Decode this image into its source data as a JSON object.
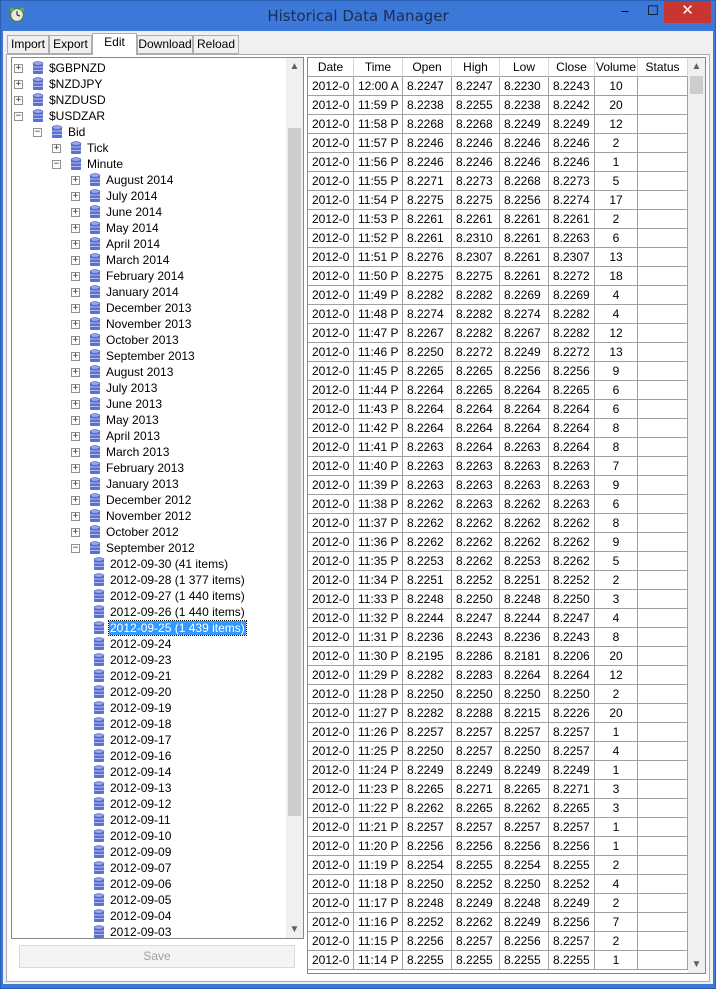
{
  "window": {
    "title": "Historical Data Manager",
    "app_icon": "clock-icon",
    "minimize": "–",
    "maximize": "☐",
    "close": "✕"
  },
  "tabs": [
    "Import",
    "Export",
    "Edit",
    "Download",
    "Reload"
  ],
  "active_tab": "Edit",
  "tree": {
    "items": [
      {
        "label": "$GBPNZD",
        "expander": "+"
      },
      {
        "label": "$NZDJPY",
        "expander": "+"
      },
      {
        "label": "$NZDUSD",
        "expander": "+"
      },
      {
        "label": "$USDZAR",
        "expander": "−"
      },
      {
        "label": "Bid",
        "expander": "−"
      },
      {
        "label": "Tick",
        "expander": "+"
      },
      {
        "label": "Minute",
        "expander": "−"
      },
      {
        "label": "August 2014",
        "expander": "+"
      },
      {
        "label": "July 2014",
        "expander": "+"
      },
      {
        "label": "June 2014",
        "expander": "+"
      },
      {
        "label": "May 2014",
        "expander": "+"
      },
      {
        "label": "April 2014",
        "expander": "+"
      },
      {
        "label": "March 2014",
        "expander": "+"
      },
      {
        "label": "February 2014",
        "expander": "+"
      },
      {
        "label": "January 2014",
        "expander": "+"
      },
      {
        "label": "December 2013",
        "expander": "+"
      },
      {
        "label": "November 2013",
        "expander": "+"
      },
      {
        "label": "October 2013",
        "expander": "+"
      },
      {
        "label": "September 2013",
        "expander": "+"
      },
      {
        "label": "August 2013",
        "expander": "+"
      },
      {
        "label": "July 2013",
        "expander": "+"
      },
      {
        "label": "June 2013",
        "expander": "+"
      },
      {
        "label": "May 2013",
        "expander": "+"
      },
      {
        "label": "April 2013",
        "expander": "+"
      },
      {
        "label": "March 2013",
        "expander": "+"
      },
      {
        "label": "February 2013",
        "expander": "+"
      },
      {
        "label": "January 2013",
        "expander": "+"
      },
      {
        "label": "December 2012",
        "expander": "+"
      },
      {
        "label": "November 2012",
        "expander": "+"
      },
      {
        "label": "October 2012",
        "expander": "+"
      },
      {
        "label": "September 2012",
        "expander": "−"
      },
      {
        "label": "2012-09-30 (41 items)",
        "expander": ""
      },
      {
        "label": "2012-09-28 (1 377 items)",
        "expander": ""
      },
      {
        "label": "2012-09-27 (1 440 items)",
        "expander": ""
      },
      {
        "label": "2012-09-26 (1 440 items)",
        "expander": ""
      },
      {
        "label": "2012-09-25 (1 439 items)",
        "expander": "",
        "selected": true
      },
      {
        "label": "2012-09-24",
        "expander": ""
      },
      {
        "label": "2012-09-23",
        "expander": ""
      },
      {
        "label": "2012-09-21",
        "expander": ""
      },
      {
        "label": "2012-09-20",
        "expander": ""
      },
      {
        "label": "2012-09-19",
        "expander": ""
      },
      {
        "label": "2012-09-18",
        "expander": ""
      },
      {
        "label": "2012-09-17",
        "expander": ""
      },
      {
        "label": "2012-09-16",
        "expander": ""
      },
      {
        "label": "2012-09-14",
        "expander": ""
      },
      {
        "label": "2012-09-13",
        "expander": ""
      },
      {
        "label": "2012-09-12",
        "expander": ""
      },
      {
        "label": "2012-09-11",
        "expander": ""
      },
      {
        "label": "2012-09-10",
        "expander": ""
      },
      {
        "label": "2012-09-09",
        "expander": ""
      },
      {
        "label": "2012-09-07",
        "expander": ""
      },
      {
        "label": "2012-09-06",
        "expander": ""
      },
      {
        "label": "2012-09-05",
        "expander": ""
      },
      {
        "label": "2012-09-04",
        "expander": ""
      },
      {
        "label": "2012-09-03",
        "expander": ""
      }
    ],
    "scroll_up": "▲",
    "scroll_down": "▼"
  },
  "save_button": "Save",
  "grid": {
    "columns": [
      "Date",
      "Time",
      "Open",
      "High",
      "Low",
      "Close",
      "Volume",
      "Status"
    ],
    "rows": [
      [
        "2012-0",
        "12:00 A",
        "8.2247",
        "8.2247",
        "8.2230",
        "8.2243",
        "10",
        ""
      ],
      [
        "2012-0",
        "11:59 P",
        "8.2238",
        "8.2255",
        "8.2238",
        "8.2242",
        "20",
        ""
      ],
      [
        "2012-0",
        "11:58 P",
        "8.2268",
        "8.2268",
        "8.2249",
        "8.2249",
        "12",
        ""
      ],
      [
        "2012-0",
        "11:57 P",
        "8.2246",
        "8.2246",
        "8.2246",
        "8.2246",
        "2",
        ""
      ],
      [
        "2012-0",
        "11:56 P",
        "8.2246",
        "8.2246",
        "8.2246",
        "8.2246",
        "1",
        ""
      ],
      [
        "2012-0",
        "11:55 P",
        "8.2271",
        "8.2273",
        "8.2268",
        "8.2273",
        "5",
        ""
      ],
      [
        "2012-0",
        "11:54 P",
        "8.2275",
        "8.2275",
        "8.2256",
        "8.2274",
        "17",
        ""
      ],
      [
        "2012-0",
        "11:53 P",
        "8.2261",
        "8.2261",
        "8.2261",
        "8.2261",
        "2",
        ""
      ],
      [
        "2012-0",
        "11:52 P",
        "8.2261",
        "8.2310",
        "8.2261",
        "8.2263",
        "6",
        ""
      ],
      [
        "2012-0",
        "11:51 P",
        "8.2276",
        "8.2307",
        "8.2261",
        "8.2307",
        "13",
        ""
      ],
      [
        "2012-0",
        "11:50 P",
        "8.2275",
        "8.2275",
        "8.2261",
        "8.2272",
        "18",
        ""
      ],
      [
        "2012-0",
        "11:49 P",
        "8.2282",
        "8.2282",
        "8.2269",
        "8.2269",
        "4",
        ""
      ],
      [
        "2012-0",
        "11:48 P",
        "8.2274",
        "8.2282",
        "8.2274",
        "8.2282",
        "4",
        ""
      ],
      [
        "2012-0",
        "11:47 P",
        "8.2267",
        "8.2282",
        "8.2267",
        "8.2282",
        "12",
        ""
      ],
      [
        "2012-0",
        "11:46 P",
        "8.2250",
        "8.2272",
        "8.2249",
        "8.2272",
        "13",
        ""
      ],
      [
        "2012-0",
        "11:45 P",
        "8.2265",
        "8.2265",
        "8.2256",
        "8.2256",
        "9",
        ""
      ],
      [
        "2012-0",
        "11:44 P",
        "8.2264",
        "8.2265",
        "8.2264",
        "8.2265",
        "6",
        ""
      ],
      [
        "2012-0",
        "11:43 P",
        "8.2264",
        "8.2264",
        "8.2264",
        "8.2264",
        "6",
        ""
      ],
      [
        "2012-0",
        "11:42 P",
        "8.2264",
        "8.2264",
        "8.2264",
        "8.2264",
        "8",
        ""
      ],
      [
        "2012-0",
        "11:41 P",
        "8.2263",
        "8.2264",
        "8.2263",
        "8.2264",
        "8",
        ""
      ],
      [
        "2012-0",
        "11:40 P",
        "8.2263",
        "8.2263",
        "8.2263",
        "8.2263",
        "7",
        ""
      ],
      [
        "2012-0",
        "11:39 P",
        "8.2263",
        "8.2263",
        "8.2263",
        "8.2263",
        "9",
        ""
      ],
      [
        "2012-0",
        "11:38 P",
        "8.2262",
        "8.2263",
        "8.2262",
        "8.2263",
        "6",
        ""
      ],
      [
        "2012-0",
        "11:37 P",
        "8.2262",
        "8.2262",
        "8.2262",
        "8.2262",
        "8",
        ""
      ],
      [
        "2012-0",
        "11:36 P",
        "8.2262",
        "8.2262",
        "8.2262",
        "8.2262",
        "9",
        ""
      ],
      [
        "2012-0",
        "11:35 P",
        "8.2253",
        "8.2262",
        "8.2253",
        "8.2262",
        "5",
        ""
      ],
      [
        "2012-0",
        "11:34 P",
        "8.2251",
        "8.2252",
        "8.2251",
        "8.2252",
        "2",
        ""
      ],
      [
        "2012-0",
        "11:33 P",
        "8.2248",
        "8.2250",
        "8.2248",
        "8.2250",
        "3",
        ""
      ],
      [
        "2012-0",
        "11:32 P",
        "8.2244",
        "8.2247",
        "8.2244",
        "8.2247",
        "4",
        ""
      ],
      [
        "2012-0",
        "11:31 P",
        "8.2236",
        "8.2243",
        "8.2236",
        "8.2243",
        "8",
        ""
      ],
      [
        "2012-0",
        "11:30 P",
        "8.2195",
        "8.2286",
        "8.2181",
        "8.2206",
        "20",
        ""
      ],
      [
        "2012-0",
        "11:29 P",
        "8.2282",
        "8.2283",
        "8.2264",
        "8.2264",
        "12",
        ""
      ],
      [
        "2012-0",
        "11:28 P",
        "8.2250",
        "8.2250",
        "8.2250",
        "8.2250",
        "2",
        ""
      ],
      [
        "2012-0",
        "11:27 P",
        "8.2282",
        "8.2288",
        "8.2215",
        "8.2226",
        "20",
        ""
      ],
      [
        "2012-0",
        "11:26 P",
        "8.2257",
        "8.2257",
        "8.2257",
        "8.2257",
        "1",
        ""
      ],
      [
        "2012-0",
        "11:25 P",
        "8.2250",
        "8.2257",
        "8.2250",
        "8.2257",
        "4",
        ""
      ],
      [
        "2012-0",
        "11:24 P",
        "8.2249",
        "8.2249",
        "8.2249",
        "8.2249",
        "1",
        ""
      ],
      [
        "2012-0",
        "11:23 P",
        "8.2265",
        "8.2271",
        "8.2265",
        "8.2271",
        "3",
        ""
      ],
      [
        "2012-0",
        "11:22 P",
        "8.2262",
        "8.2265",
        "8.2262",
        "8.2265",
        "3",
        ""
      ],
      [
        "2012-0",
        "11:21 P",
        "8.2257",
        "8.2257",
        "8.2257",
        "8.2257",
        "1",
        ""
      ],
      [
        "2012-0",
        "11:20 P",
        "8.2256",
        "8.2256",
        "8.2256",
        "8.2256",
        "1",
        ""
      ],
      [
        "2012-0",
        "11:19 P",
        "8.2254",
        "8.2255",
        "8.2254",
        "8.2255",
        "2",
        ""
      ],
      [
        "2012-0",
        "11:18 P",
        "8.2250",
        "8.2252",
        "8.2250",
        "8.2252",
        "4",
        ""
      ],
      [
        "2012-0",
        "11:17 P",
        "8.2248",
        "8.2249",
        "8.2248",
        "8.2249",
        "2",
        ""
      ],
      [
        "2012-0",
        "11:16 P",
        "8.2252",
        "8.2262",
        "8.2249",
        "8.2256",
        "7",
        ""
      ],
      [
        "2012-0",
        "11:15 P",
        "8.2256",
        "8.2257",
        "8.2256",
        "8.2257",
        "2",
        ""
      ],
      [
        "2012-0",
        "11:14 P",
        "8.2255",
        "8.2255",
        "8.2255",
        "8.2255",
        "1",
        ""
      ]
    ],
    "scroll_up": "▲",
    "scroll_down": "▼"
  },
  "colors": {
    "titlebar": "#3c78d8",
    "close_button": "#c7372f",
    "selection": "#3399ff",
    "db_icon": "#5b6fd6"
  }
}
